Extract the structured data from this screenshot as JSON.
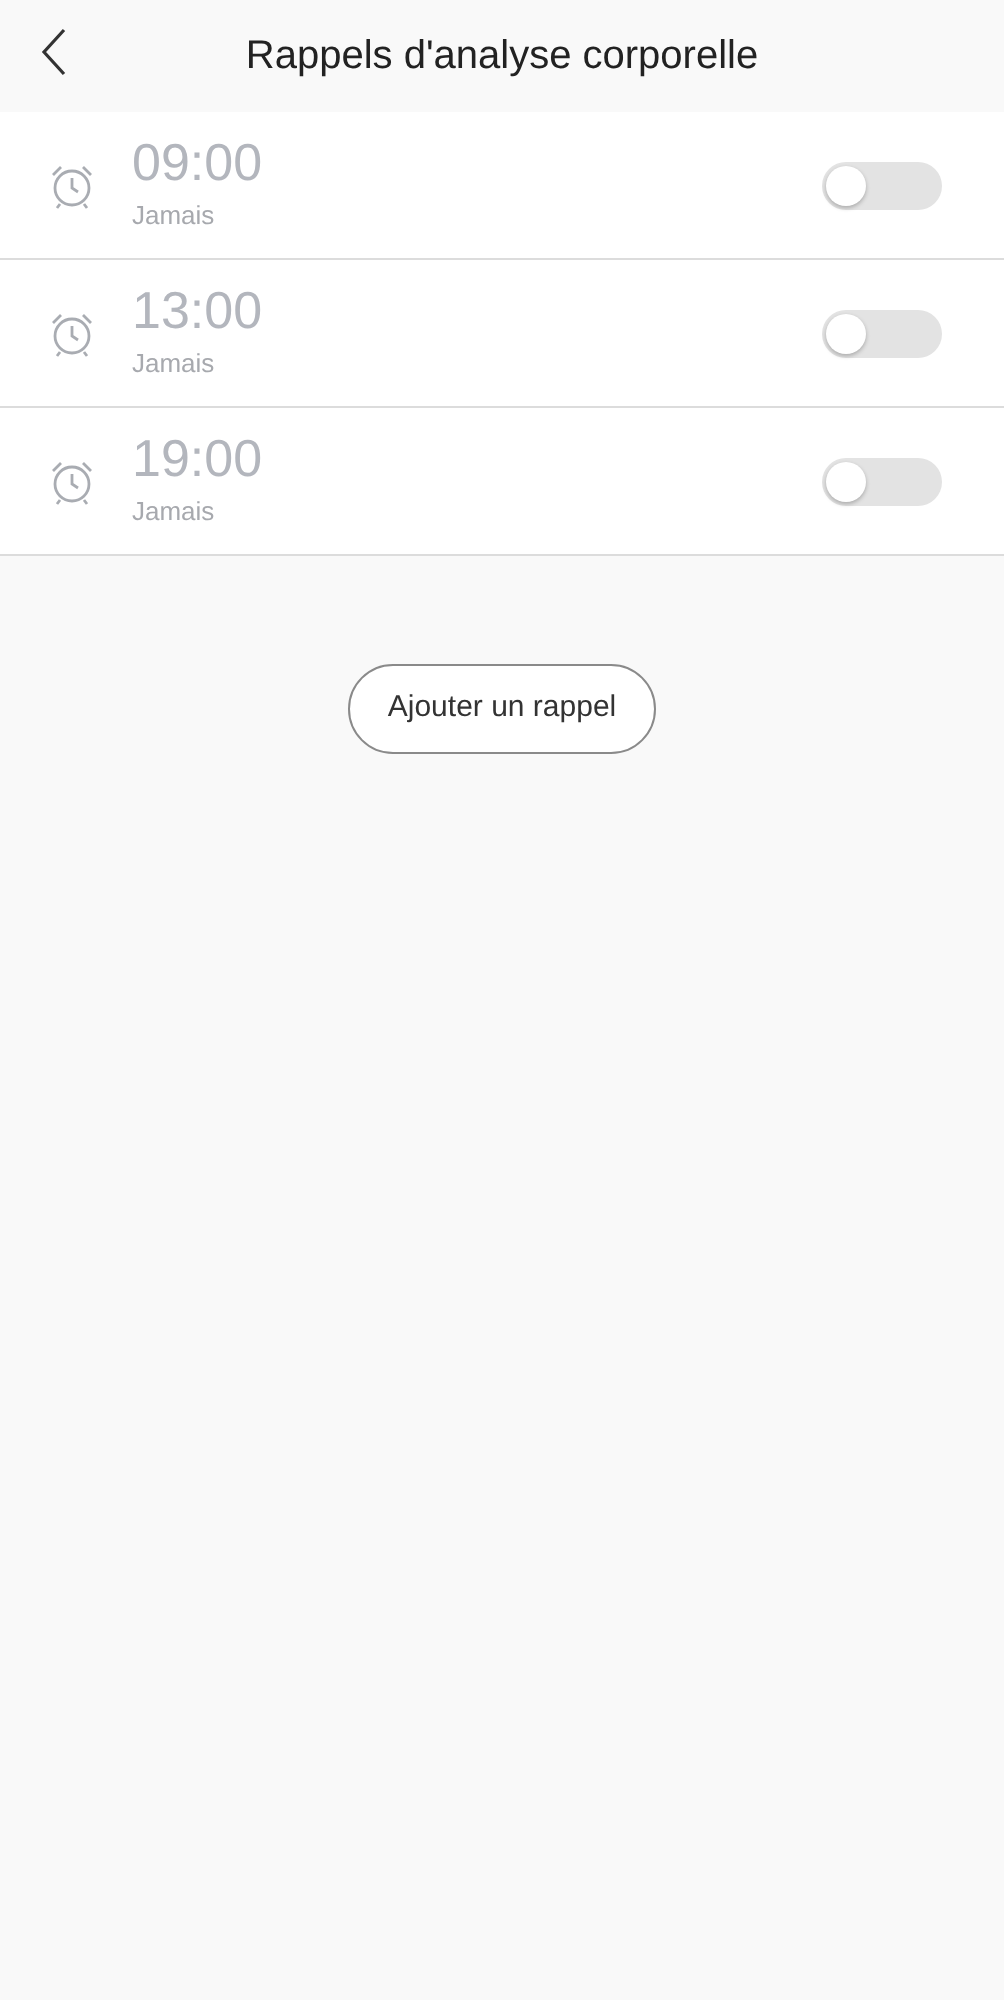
{
  "header": {
    "title": "Rappels d'analyse corporelle"
  },
  "reminders": [
    {
      "time": "09:00",
      "repeat": "Jamais",
      "on": false
    },
    {
      "time": "13:00",
      "repeat": "Jamais",
      "on": false
    },
    {
      "time": "19:00",
      "repeat": "Jamais",
      "on": false
    }
  ],
  "add_button": "Ajouter un rappel"
}
